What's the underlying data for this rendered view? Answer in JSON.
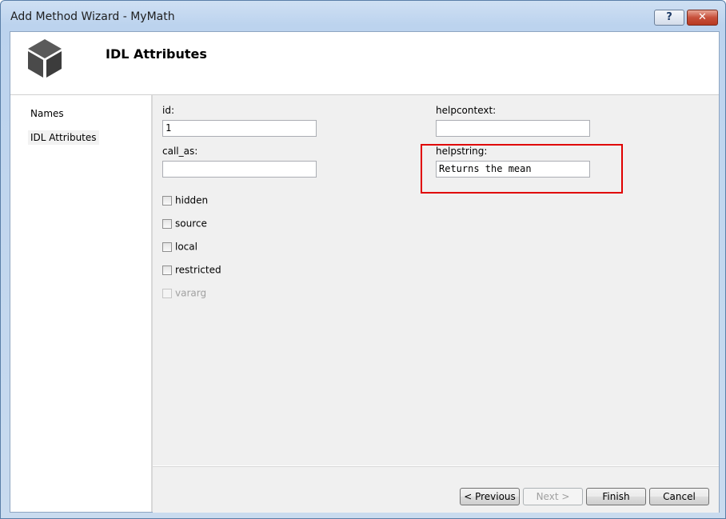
{
  "window": {
    "title": "Add Method Wizard - MyMath",
    "help_glyph": "?",
    "close_glyph": "✕"
  },
  "header": {
    "heading": "IDL Attributes"
  },
  "sidebar": {
    "items": [
      {
        "label": "Names"
      },
      {
        "label": "IDL Attributes",
        "selected": true
      }
    ]
  },
  "form": {
    "id": {
      "label": "id:",
      "value": "1"
    },
    "call_as": {
      "label": "call_as:",
      "value": ""
    },
    "helpcontext": {
      "label": "helpcontext:",
      "value": ""
    },
    "helpstring": {
      "label": "helpstring:",
      "value": "Returns the mean"
    },
    "checkboxes": [
      {
        "label": "hidden",
        "checked": false,
        "enabled": true
      },
      {
        "label": "source",
        "checked": false,
        "enabled": true
      },
      {
        "label": "local",
        "checked": false,
        "enabled": true
      },
      {
        "label": "restricted",
        "checked": false,
        "enabled": true
      },
      {
        "label": "vararg",
        "checked": false,
        "enabled": false
      }
    ]
  },
  "buttons": {
    "previous": "< Previous",
    "next": "Next >",
    "finish": "Finish",
    "cancel": "Cancel"
  },
  "colors": {
    "highlight": "#e00000",
    "title_bar": "#bcd3ee"
  }
}
